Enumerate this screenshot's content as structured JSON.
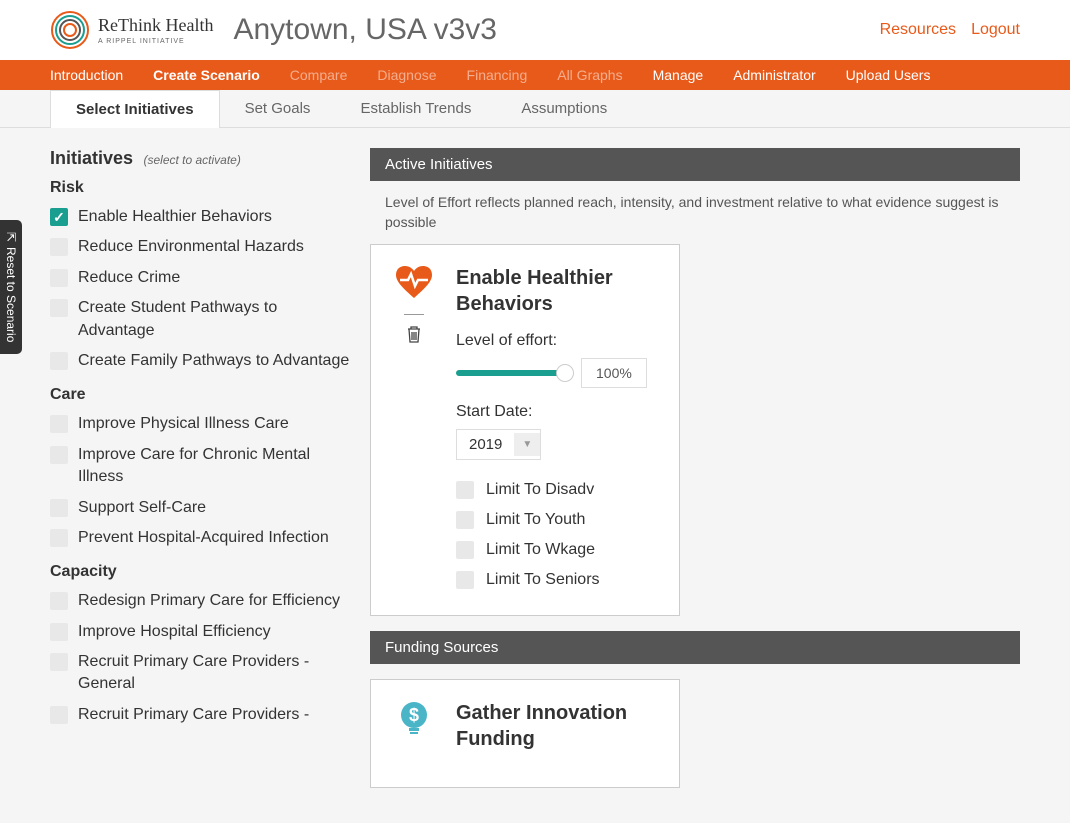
{
  "header": {
    "logoTitle": "ReThink Health",
    "logoSubtitle": "A RIPPEL INITIATIVE",
    "pageTitle": "Anytown, USA v3v3",
    "links": {
      "resources": "Resources",
      "logout": "Logout"
    }
  },
  "nav": {
    "introduction": "Introduction",
    "createScenario": "Create Scenario",
    "compare": "Compare",
    "diagnose": "Diagnose",
    "financing": "Financing",
    "allGraphs": "All Graphs",
    "manage": "Manage",
    "administrator": "Administrator",
    "uploadUsers": "Upload Users"
  },
  "tabs": {
    "selectInitiatives": "Select Initiatives",
    "setGoals": "Set Goals",
    "establishTrends": "Establish Trends",
    "assumptions": "Assumptions"
  },
  "resetButton": "Reset to Scenario",
  "initiativesPanel": {
    "heading": "Initiatives",
    "subtext": "(select to activate)",
    "categories": {
      "risk": {
        "title": "Risk",
        "items": [
          {
            "label": "Enable Healthier Behaviors",
            "checked": true
          },
          {
            "label": "Reduce Environmental Hazards",
            "checked": false
          },
          {
            "label": "Reduce Crime",
            "checked": false
          },
          {
            "label": "Create Student Pathways to Advantage",
            "checked": false
          },
          {
            "label": "Create Family Pathways to Advantage",
            "checked": false
          }
        ]
      },
      "care": {
        "title": "Care",
        "items": [
          {
            "label": "Improve Physical Illness Care",
            "checked": false
          },
          {
            "label": "Improve Care for Chronic Mental Illness",
            "checked": false
          },
          {
            "label": "Support Self-Care",
            "checked": false
          },
          {
            "label": "Prevent Hospital-Acquired Infection",
            "checked": false
          }
        ]
      },
      "capacity": {
        "title": "Capacity",
        "items": [
          {
            "label": "Redesign Primary Care for Efficiency",
            "checked": false
          },
          {
            "label": "Improve Hospital Efficiency",
            "checked": false
          },
          {
            "label": "Recruit Primary Care Providers - General",
            "checked": false
          },
          {
            "label": "Recruit Primary Care Providers -",
            "checked": false
          }
        ]
      }
    }
  },
  "activeSection": {
    "header": "Active Initiatives",
    "description": "Level of Effort reflects planned reach, intensity, and investment relative to what evidence suggest is possible",
    "card": {
      "title": "Enable Healthier Behaviors",
      "effortLabel": "Level of effort:",
      "effortValue": "100%",
      "startDateLabel": "Start Date:",
      "startDateValue": "2019",
      "limits": [
        "Limit To Disadv",
        "Limit To Youth",
        "Limit To Wkage",
        "Limit To Seniors"
      ]
    }
  },
  "fundingSection": {
    "header": "Funding Sources",
    "card": {
      "title": "Gather Innovation Funding"
    }
  }
}
